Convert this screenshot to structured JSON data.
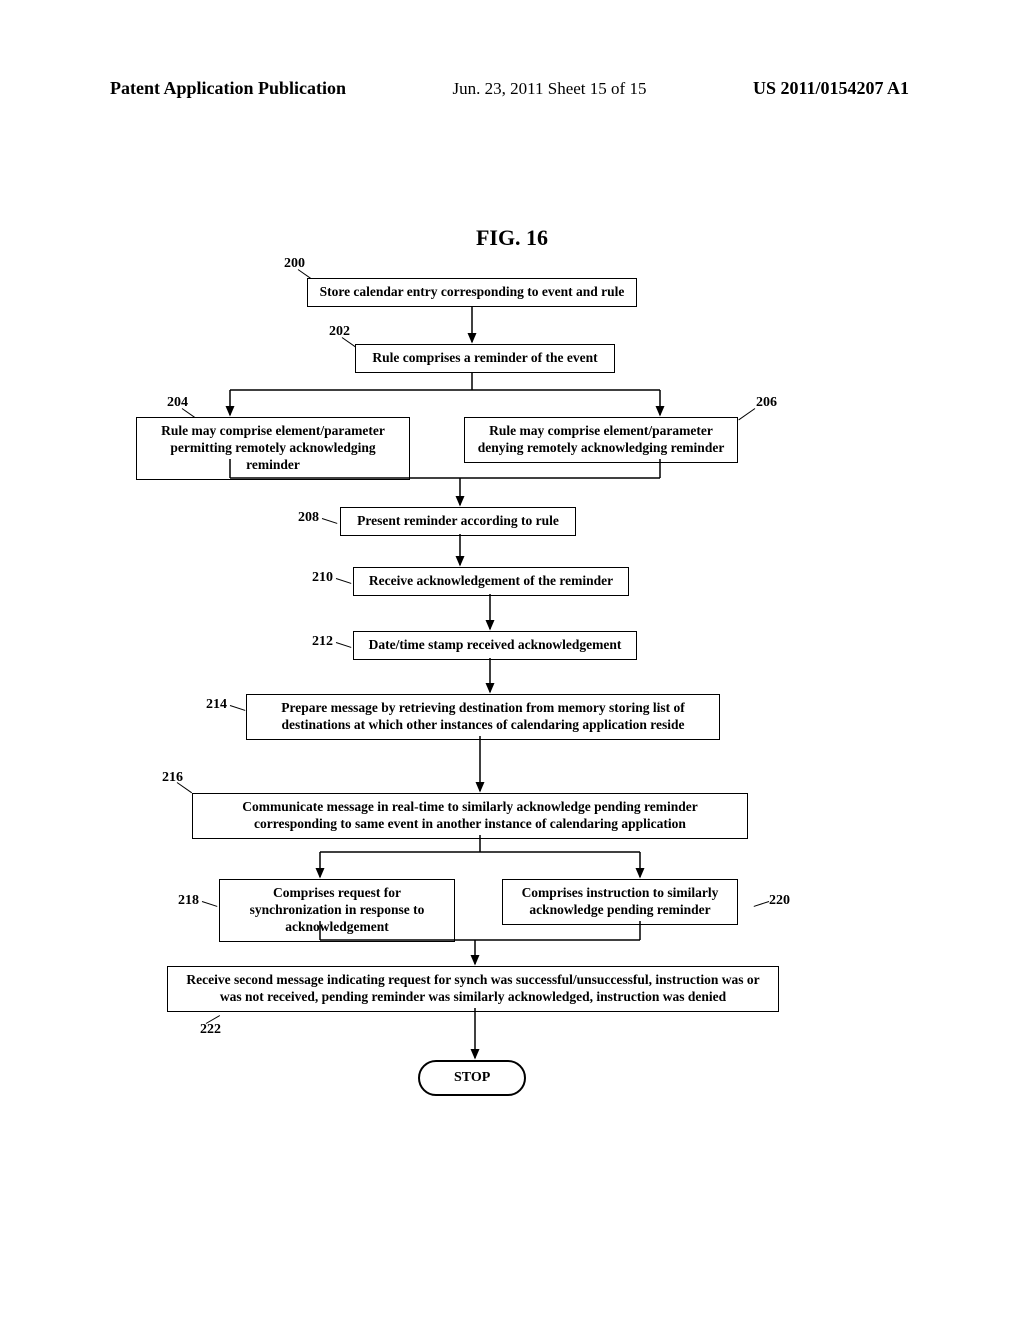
{
  "header": {
    "left": "Patent Application Publication",
    "mid": "Jun. 23, 2011  Sheet 15 of 15",
    "right": "US 2011/0154207 A1"
  },
  "figure_title": "FIG. 16",
  "refs": {
    "r200": "200",
    "r202": "202",
    "r204": "204",
    "r206": "206",
    "r208": "208",
    "r210": "210",
    "r212": "212",
    "r214": "214",
    "r216": "216",
    "r218": "218",
    "r220": "220",
    "r222": "222"
  },
  "boxes": {
    "b200": "Store calendar entry corresponding to event and rule",
    "b202": "Rule comprises a reminder of the event",
    "b204": "Rule may comprise element/parameter permitting remotely acknowledging reminder",
    "b206": "Rule may comprise element/parameter denying remotely acknowledging reminder",
    "b208": "Present reminder according to rule",
    "b210": "Receive acknowledgement of the reminder",
    "b212": "Date/time stamp received acknowledgement",
    "b214": "Prepare message by retrieving destination from memory storing list of destinations at which other instances of calendaring application reside",
    "b216": "Communicate message in real-time to similarly acknowledge pending reminder corresponding to same event in another instance of calendaring application",
    "b218": "Comprises request for synchronization in response to acknowledgement",
    "b220": "Comprises instruction to similarly acknowledge pending reminder",
    "b222": "Receive second message indicating request for synch was successful/unsuccessful, instruction was or was not received, pending reminder was similarly acknowledged, instruction was denied"
  },
  "stop": "STOP"
}
